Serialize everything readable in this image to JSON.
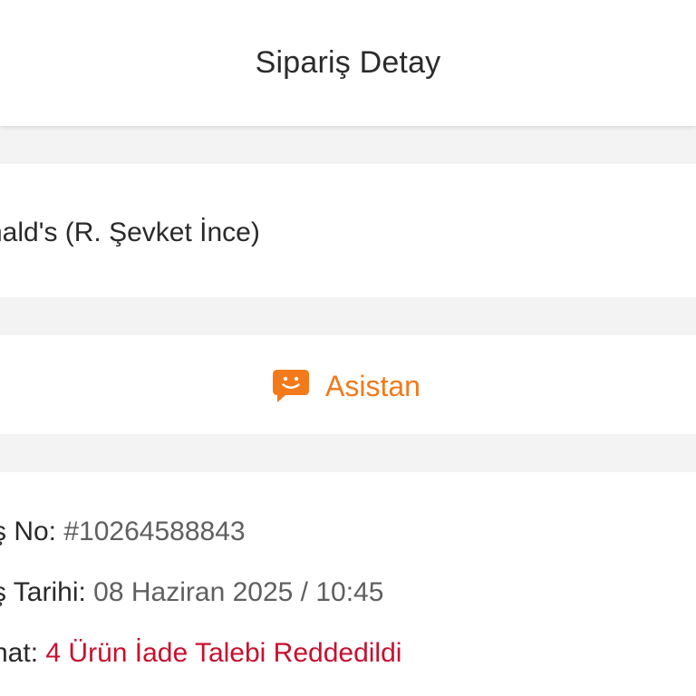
{
  "header": {
    "title": "Sipariş Detay"
  },
  "restaurant": {
    "name": "nald's (R. Şevket İnce)"
  },
  "assistant": {
    "label": "Asistan",
    "icon": "chat-smile-icon",
    "color": "#f27a1a"
  },
  "order": {
    "number_label": "ş No:",
    "number_value": "#10264588843",
    "date_label": "ş Tarihi:",
    "date_value": "08 Haziran 2025 / 10:45",
    "status_label": "nat:",
    "status_value": "4 Ürün İade Talebi Reddedildi",
    "status_color": "#c8102e"
  }
}
